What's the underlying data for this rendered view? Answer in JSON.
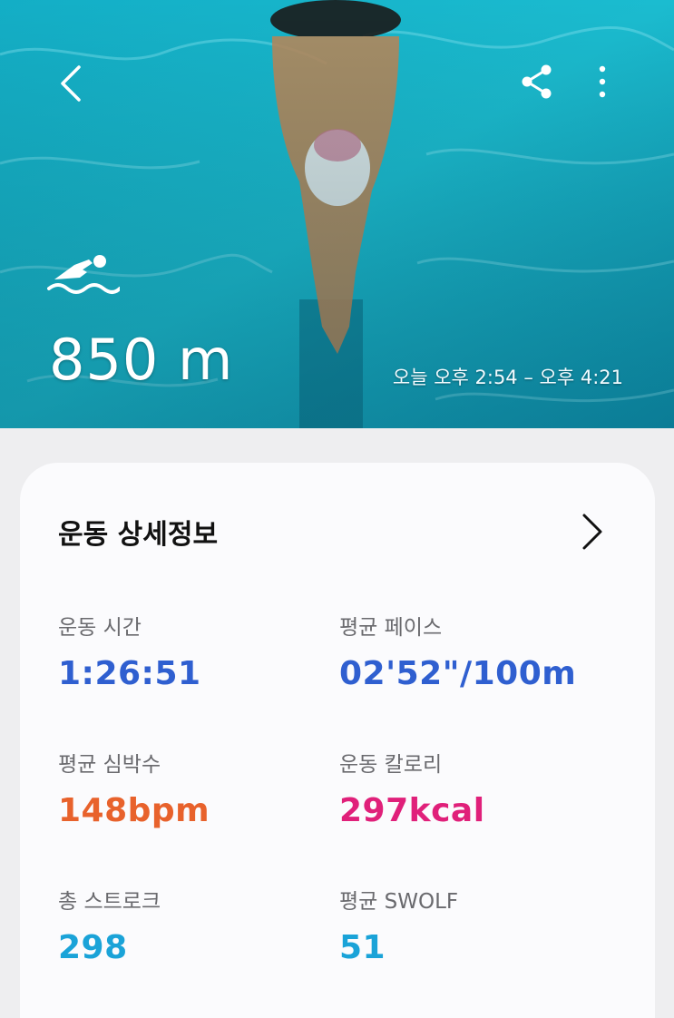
{
  "header": {
    "back_icon": "chevron-left-icon",
    "share_icon": "share-icon",
    "more_icon": "more-vertical-icon",
    "activity_icon": "swimming-icon",
    "distance": "850 m",
    "time_range": "오늘 오후 2:54 – 오후 4:21"
  },
  "card": {
    "title": "운동 상세정보",
    "stats": [
      {
        "label": "운동 시간",
        "value": "1:26:51",
        "color": "#2f5fd0"
      },
      {
        "label": "평균 페이스",
        "value": "02'52\"/100m",
        "color": "#2f5fd0"
      },
      {
        "label": "평균 심박수",
        "value": "148bpm",
        "color": "#e8622c"
      },
      {
        "label": "운동 칼로리",
        "value": "297kcal",
        "color": "#e0207a"
      },
      {
        "label": "총 스트로크",
        "value": "298",
        "color": "#1aa3d8"
      },
      {
        "label": "평균 SWOLF",
        "value": "51",
        "color": "#1aa3d8"
      }
    ]
  },
  "colors": {
    "water": "#19b6cc",
    "card_bg": "#fbfbfd",
    "page_bg": "#eeeef0"
  }
}
